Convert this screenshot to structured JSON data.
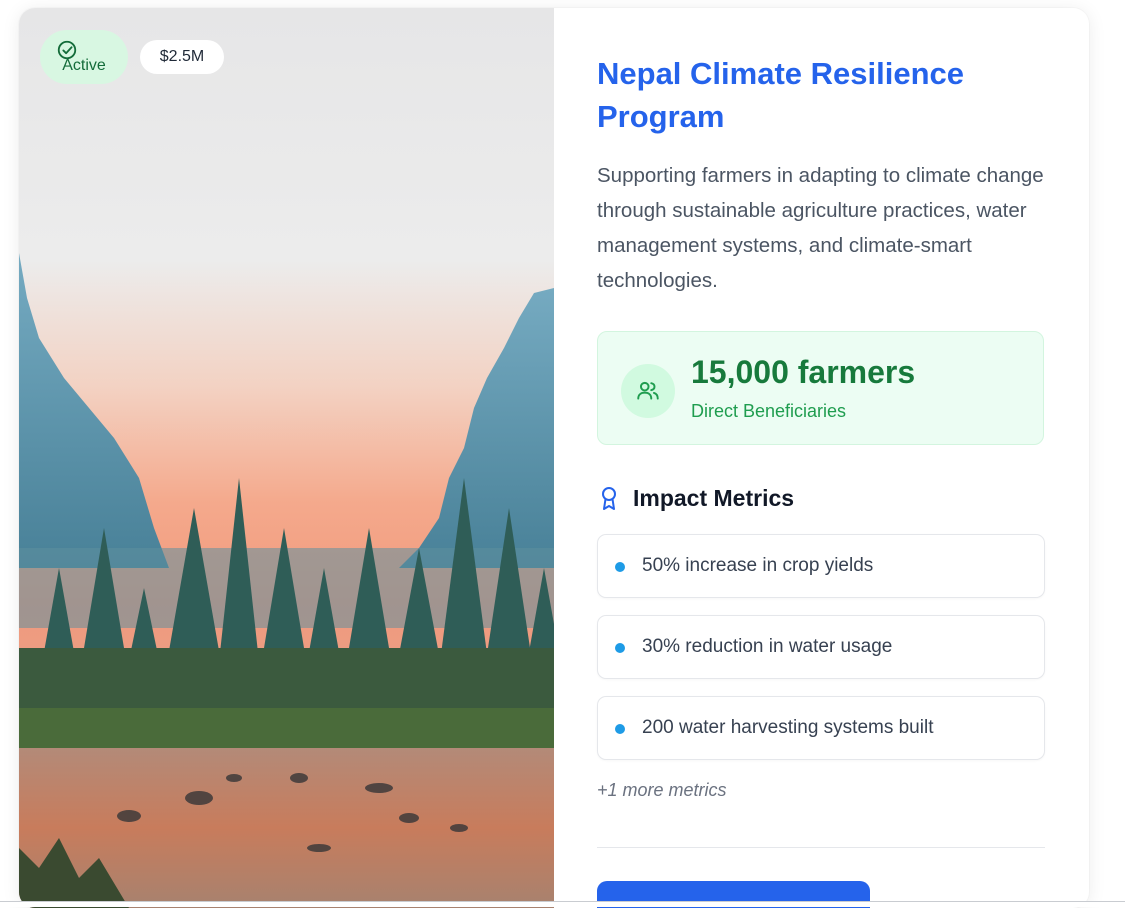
{
  "project": {
    "status": "Active",
    "budget": "$2.5M",
    "title": "Nepal Climate Resilience Program",
    "description": "Supporting farmers in adapting to climate change through sustainable agriculture practices, water management systems, and climate-smart technologies.",
    "beneficiaries": {
      "value": "15,000 farmers",
      "label": "Direct Beneficiaries"
    },
    "impact": {
      "heading": "Impact Metrics",
      "items": [
        "50% increase in crop yields",
        "30% reduction in water usage",
        "200 water harvesting systems built"
      ],
      "more": "+1 more metrics"
    },
    "cta_label": ""
  },
  "icons": {
    "status": "check-circle-icon",
    "beneficiaries": "users-icon",
    "impact": "award-icon",
    "metric_bullet": "dot-icon"
  },
  "colors": {
    "accent": "#2563eb",
    "success": "#177a3c",
    "success_bg": "#ecfdf3",
    "bullet": "#1e9be6"
  }
}
